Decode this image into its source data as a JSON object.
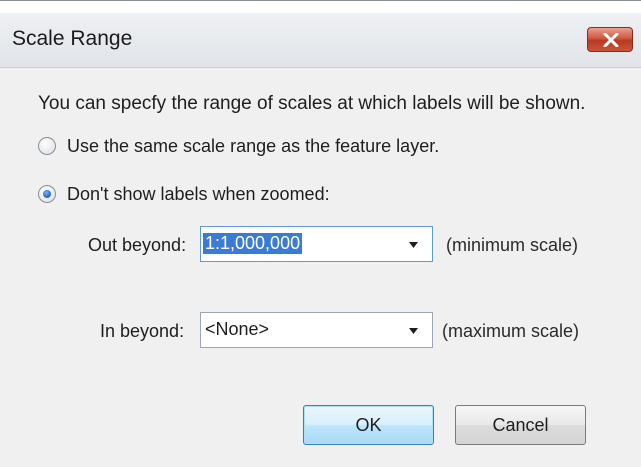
{
  "window": {
    "title": "Scale Range"
  },
  "description": "You can specfy the range of scales at which labels will be shown.",
  "options": [
    {
      "label": "Use the same scale range as the feature layer.",
      "checked": false
    },
    {
      "label": "Don't show labels when zoomed:",
      "checked": true
    }
  ],
  "out_beyond": {
    "label": "Out beyond:",
    "value": "1:1,000,000",
    "hint": "(minimum scale)"
  },
  "in_beyond": {
    "label": "In beyond:",
    "value": "<None>",
    "hint": "(maximum scale)"
  },
  "buttons": {
    "ok": "OK",
    "cancel": "Cancel"
  },
  "icons": {
    "close": "close-icon",
    "dropdown": "chevron-down-icon"
  },
  "colors": {
    "close_button": "#c8553c",
    "selection": "#3a7bd5",
    "default_button": "#bee6fd"
  }
}
